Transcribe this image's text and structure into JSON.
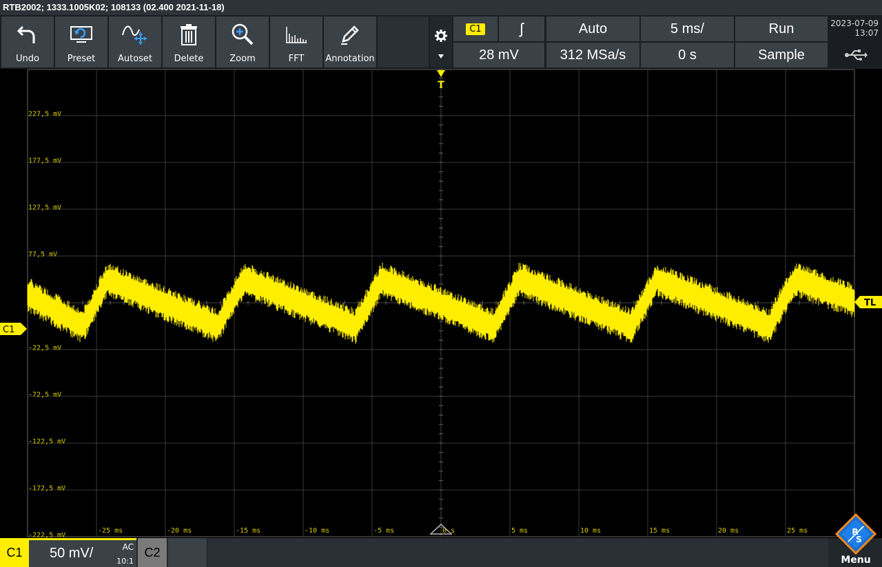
{
  "titlebar": {
    "text": "RTB2002; 1333.1005K02; 108133 (02.400 2021-11-18)"
  },
  "toolbar": {
    "buttons": [
      {
        "label": "Undo",
        "icon": "undo-icon"
      },
      {
        "label": "Preset",
        "icon": "preset-icon"
      },
      {
        "label": "Autoset",
        "icon": "autoset-icon"
      },
      {
        "label": "Delete",
        "icon": "trash-icon"
      },
      {
        "label": "Zoom",
        "icon": "zoom-icon"
      },
      {
        "label": "FFT",
        "icon": "fft-icon"
      },
      {
        "label": "Annotation",
        "icon": "pencil-icon"
      }
    ]
  },
  "trigger": {
    "source": "C1",
    "slope_glyph": "ʃ",
    "mode": "Auto",
    "level": "28 mV",
    "sample_rate": "312 MSa/s",
    "timebase": "5 ms/",
    "position": "0 s",
    "run_state": "Run",
    "acquisition": "Sample"
  },
  "datetime": {
    "date": "2023-07-09",
    "time": "13:07"
  },
  "screen": {
    "trigger_marker": "T",
    "trigger_level_marker": "TL",
    "channel_marker": "C1",
    "trace_color": "#ffee00",
    "grid_color": "#3a3a3a"
  },
  "channel": {
    "name": "C1",
    "scale": "50 mV/",
    "coupling": "AC",
    "probe": "10:1",
    "c2_label": "C2"
  },
  "menu": {
    "label": "Menu",
    "logo_text": "R&S"
  },
  "chart_data": {
    "type": "line",
    "y_tick_labels": [
      "227,5 mV",
      "177,5 mV",
      "127,5 mV",
      "77,5 mV",
      "27,5 mV",
      "-22,5 mV",
      "-72,5 mV",
      "-122,5 mV",
      "-172,5 mV",
      "-222,5 mV"
    ],
    "x_tick_labels": [
      "-25 ms",
      "-20 ms",
      "-15 ms",
      "-10 ms",
      "-5 ms",
      "0 s",
      "5 ms",
      "10 ms",
      "15 ms",
      "20 ms",
      "25 ms"
    ],
    "xlim": [
      -30,
      30
    ],
    "ylim": [
      -225,
      275
    ],
    "x_unit": "ms",
    "y_unit": "mV",
    "series": [
      {
        "x": [
          -30,
          -26,
          -24.2,
          -16.2,
          -14.3,
          -6.2,
          -4.3,
          3.8,
          5.7,
          13.8,
          15.7,
          23.8,
          25.7,
          30
        ],
        "y": [
          34,
          0,
          50,
          0,
          50,
          0,
          50,
          0,
          50,
          0,
          50,
          0,
          50,
          27
        ]
      }
    ],
    "noise_amplitude": 10,
    "grid": true
  }
}
